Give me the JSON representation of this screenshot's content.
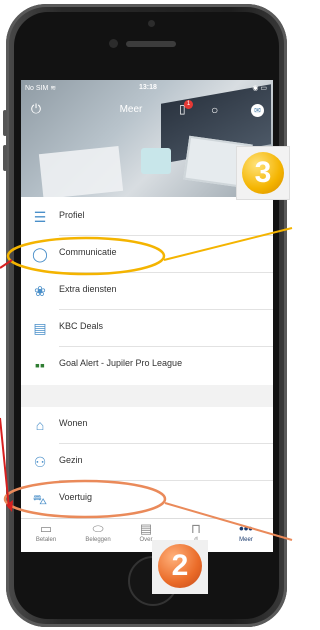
{
  "status": {
    "carrier": "No SIM",
    "time": "13:18"
  },
  "nav": {
    "title": "Meer",
    "notification_count": "1"
  },
  "menu_group1": [
    {
      "label": "Profiel",
      "icon": "profile-icon"
    },
    {
      "label": "Communicatie",
      "icon": "speech-bubble-icon"
    },
    {
      "label": "Extra diensten",
      "icon": "flower-icon"
    },
    {
      "label": "KBC Deals",
      "icon": "ticket-icon"
    },
    {
      "label": "Goal Alert - Jupiler Pro League",
      "icon": "goal-alert-icon"
    }
  ],
  "menu_group2": [
    {
      "label": "Wonen",
      "icon": "house-icon"
    },
    {
      "label": "Gezin",
      "icon": "family-icon"
    },
    {
      "label": "Voertuig",
      "icon": "car-icon"
    }
  ],
  "tabs": [
    {
      "label": "Betalen",
      "icon": "wallet-icon"
    },
    {
      "label": "Beleggen",
      "icon": "piggy-bank-icon"
    },
    {
      "label": "Over",
      "icon": "document-icon"
    },
    {
      "label": "d",
      "icon": "cart-icon"
    },
    {
      "label": "Meer",
      "icon": "more-dots-icon"
    }
  ],
  "callouts": {
    "step_top": "3",
    "step_bottom": "2"
  },
  "colors": {
    "accent": "#4a8fc9",
    "highlight_yellow": "#f4b400",
    "highlight_orange": "#ea6b28",
    "arrow_red": "#d62020"
  }
}
